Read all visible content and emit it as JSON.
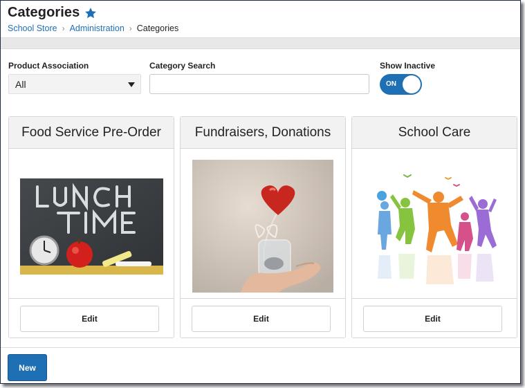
{
  "header": {
    "title": "Categories",
    "star_icon": "star-icon",
    "breadcrumb": [
      "School Store",
      "Administration",
      "Categories"
    ]
  },
  "filters": {
    "product_association": {
      "label": "Product Association",
      "value": "All"
    },
    "category_search": {
      "label": "Category Search",
      "value": "",
      "placeholder": ""
    },
    "show_inactive": {
      "label": "Show Inactive",
      "state": "ON"
    }
  },
  "cards": [
    {
      "title": "Food Service Pre-Order",
      "image": "lunch-time-chalkboard-image",
      "edit_label": "Edit"
    },
    {
      "title": "Fundraisers, Donations",
      "image": "heart-in-jar-image",
      "edit_label": "Edit"
    },
    {
      "title": "School Care",
      "image": "jumping-children-image",
      "edit_label": "Edit"
    }
  ],
  "footer": {
    "new_label": "New"
  },
  "colors": {
    "accent": "#1f6fb5",
    "panel": "#f2f2f2",
    "frame": "#1f2a44"
  }
}
